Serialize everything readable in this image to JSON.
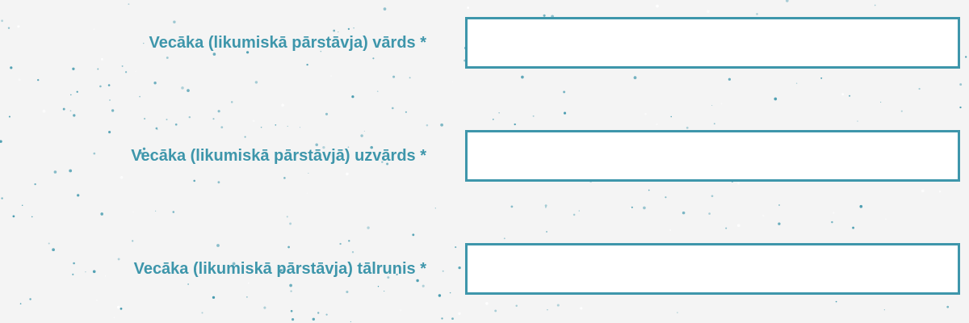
{
  "colors": {
    "background": "#f4f4f4",
    "label_text": "#3e96ab",
    "input_border": "#3e96ab",
    "speckle": "#3e96ab"
  },
  "form": {
    "fields": [
      {
        "label": "Vecāka (likumiskā pārstāvja) vārds *",
        "value": "",
        "placeholder": ""
      },
      {
        "label": "Vecāka (likumiskā pārstāvjā) uzvārds *",
        "value": "",
        "placeholder": ""
      },
      {
        "label": "Vecāka (likumiskā pārstāvja) tālrunis *",
        "value": "",
        "placeholder": ""
      }
    ]
  }
}
